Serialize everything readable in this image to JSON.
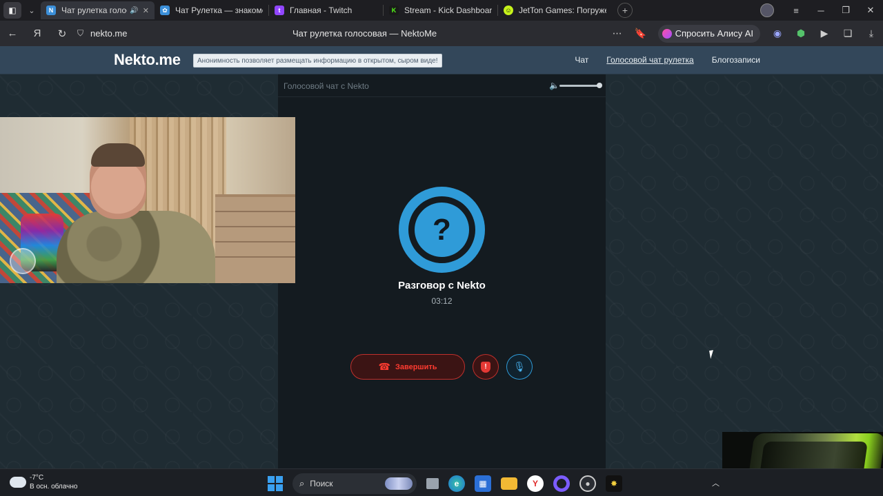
{
  "browser": {
    "tabs": [
      {
        "title": "Чат рулетка голосо",
        "favicon_color": "#3b8fd9",
        "active": true,
        "audio": true
      },
      {
        "title": "Чат Рулетка — знакомств",
        "favicon_color": "#3b8fd9",
        "active": false
      },
      {
        "title": "Главная - Twitch",
        "favicon_color": "#9146ff",
        "active": false
      },
      {
        "title": "Stream - Kick Dashboard",
        "favicon_color": "#53fc18",
        "active": false
      },
      {
        "title": "JetTon Games: Погружени",
        "favicon_color": "#c6f21b",
        "active": false
      }
    ],
    "url": "nekto.me",
    "page_title": "Чат рулетка голосовая — NektoMe",
    "alice_label": "Спросить Алису AI"
  },
  "site": {
    "logo": "Nekto.me",
    "slogan": "Анонимность позволяет размещать информацию в открытом, сыром виде!",
    "nav": {
      "chat": "Чат",
      "voice_roulette": "Голосовой чат рулетка",
      "blogs": "Блогозаписи"
    }
  },
  "chat": {
    "panel_title": "Голосовой чат с Nekto",
    "volume_level": 1.0,
    "avatar_symbol": "?",
    "conversation_title": "Разговор с Nekto",
    "timer": "03:12",
    "end_button": "Завершить",
    "report_symbol": "!",
    "accent_color": "#2f9bd8",
    "danger_color": "#ff3b30"
  },
  "taskbar": {
    "weather_temp": "-7°C",
    "weather_desc": "В осн. облачно",
    "search_placeholder": "Поиск"
  }
}
